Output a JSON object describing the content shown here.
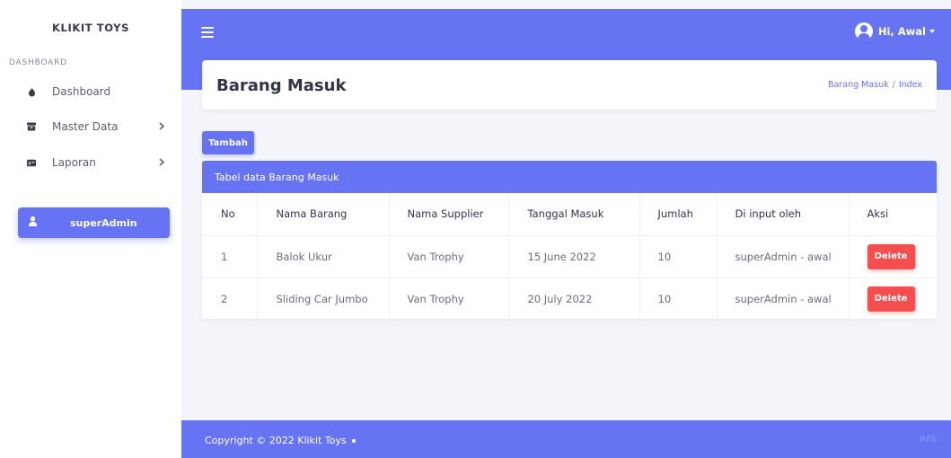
{
  "app": {
    "brand": "KLIKIT TOYS"
  },
  "sidebar": {
    "section_label": "DASHBOARD",
    "items": [
      {
        "label": "Dashboard",
        "icon": "fire-icon"
      },
      {
        "label": "Master Data",
        "icon": "box-icon"
      },
      {
        "label": "Laporan",
        "icon": "report-icon"
      }
    ],
    "user_label": "superAdmin"
  },
  "topbar": {
    "user_greeting": "Hi, Awal"
  },
  "header": {
    "title": "Barang Masuk",
    "breadcrumb": [
      "Barang Masuk",
      "/",
      "Index"
    ]
  },
  "actions": {
    "tambah_label": "Tambah"
  },
  "table": {
    "caption": "Tabel data Barang Masuk",
    "columns": [
      "No",
      "Nama Barang",
      "Nama Supplier",
      "Tanggal Masuk",
      "Jumlah",
      "Di input oleh",
      "Aksi"
    ],
    "rows": [
      [
        "1",
        "Balok Ukur",
        "Van Trophy",
        "15 June 2022",
        "10",
        "superAdmin - awal",
        "Delete"
      ],
      [
        "2",
        "Sliding Car Jumbo",
        "Van Trophy",
        "20 July 2022",
        "10",
        "superAdmin - awal",
        "Delete"
      ]
    ]
  },
  "footer": {
    "copyright": "Copyright © 2022 Klikit Toys",
    "right_text": "RFA"
  },
  "colors": {
    "primary": "#6674f4",
    "danger": "#f54e4e",
    "background": "#f4f5fa"
  }
}
